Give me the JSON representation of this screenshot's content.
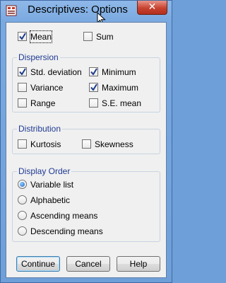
{
  "window": {
    "title": "Descriptives: Options",
    "close_symbol": "✕"
  },
  "top_checks": [
    {
      "label": "Mean",
      "checked": true
    },
    {
      "label": "Sum",
      "checked": false
    }
  ],
  "dispersion": {
    "title": "Dispersion",
    "items": [
      {
        "label": "Std. deviation",
        "checked": true
      },
      {
        "label": "Minimum",
        "checked": true
      },
      {
        "label": "Variance",
        "checked": false
      },
      {
        "label": "Maximum",
        "checked": true
      },
      {
        "label": "Range",
        "checked": false
      },
      {
        "label": "S.E. mean",
        "checked": false
      }
    ]
  },
  "distribution": {
    "title": "Distribution",
    "items": [
      {
        "label": "Kurtosis",
        "checked": false
      },
      {
        "label": "Skewness",
        "checked": false
      }
    ]
  },
  "display_order": {
    "title": "Display Order",
    "options": [
      {
        "label": "Variable list",
        "selected": true
      },
      {
        "label": "Alphabetic",
        "selected": false
      },
      {
        "label": "Ascending means",
        "selected": false
      },
      {
        "label": "Descending means",
        "selected": false
      }
    ]
  },
  "buttons": {
    "continue": "Continue",
    "cancel": "Cancel",
    "help": "Help"
  },
  "colors": {
    "accent": "#1f3a93",
    "check": "#1a3a8a",
    "radio": "#1a62c8",
    "close": "#c7422f"
  }
}
